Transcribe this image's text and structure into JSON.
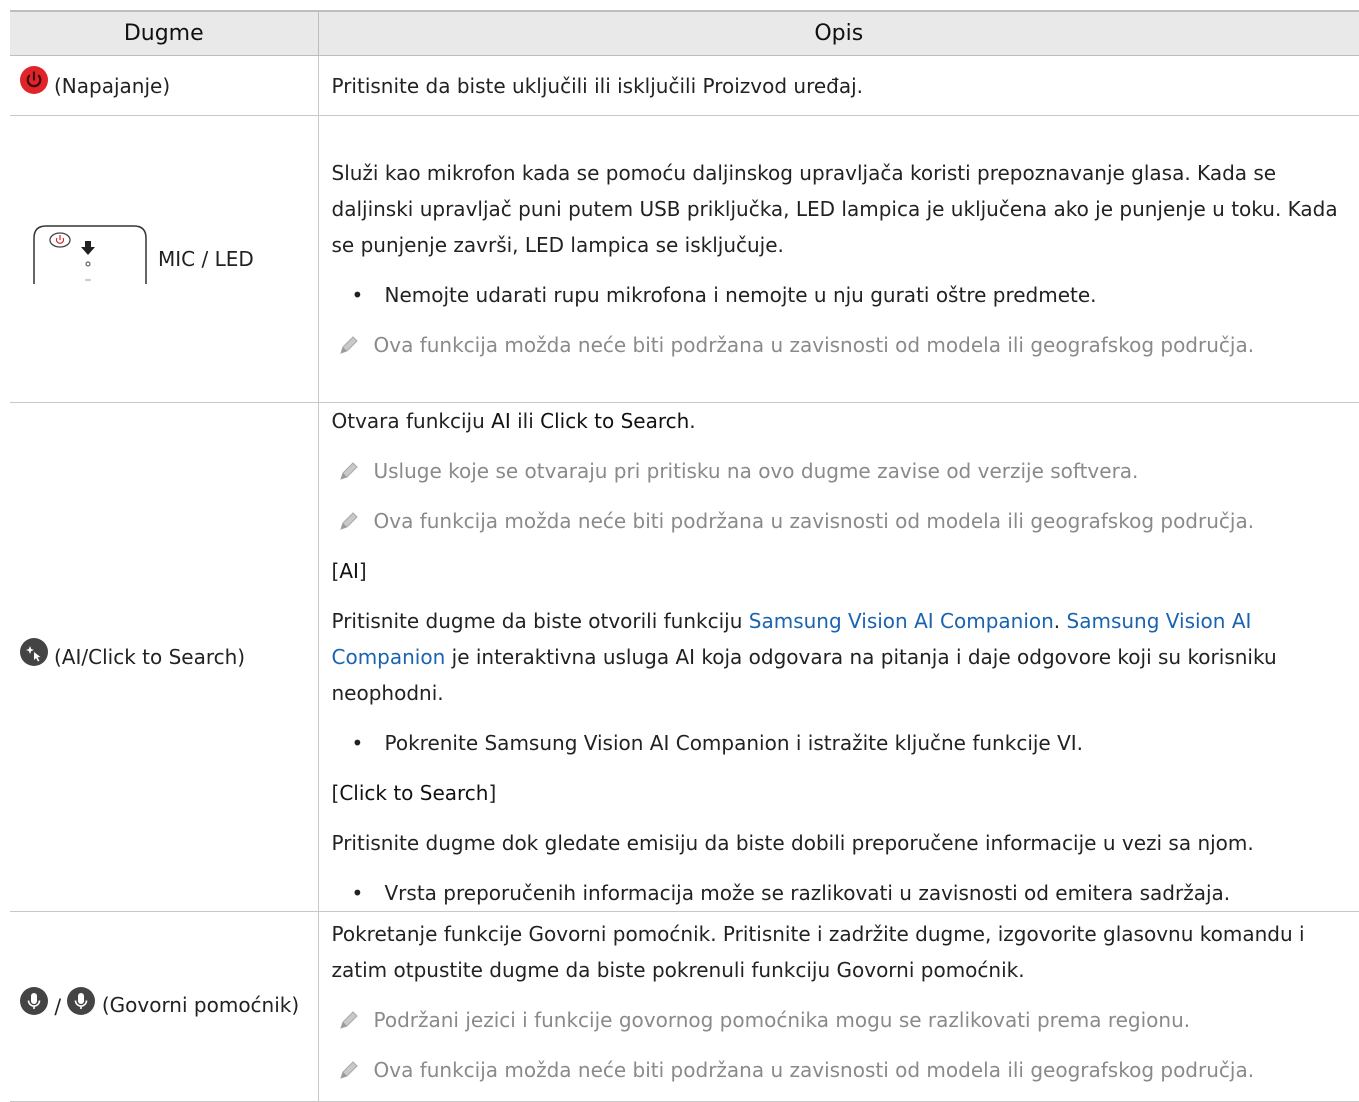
{
  "header": {
    "col1": "Dugme",
    "col2": "Opis"
  },
  "colors": {
    "power_red": "#e0242a",
    "icon_dark": "#444444",
    "link_blue": "#1a63b0",
    "note_gray": "#8a8a8a"
  },
  "rows": [
    {
      "label": "(Napajanje)",
      "icon": "power-icon",
      "description": "Pritisnite da biste uključili ili isključili Proizvod uređaj."
    },
    {
      "label": "MIC / LED",
      "icon": "remote-mic-led-icon",
      "p1": "Služi kao mikrofon kada se pomoću daljinskog upravljača koristi prepoznavanje glasa. Kada se daljinski upravljač puni putem USB priključka, LED lampica je uključena ako je punjenje u toku. Kada se punjenje završi, LED lampica se isključuje.",
      "bullet": "Nemojte udarati rupu mikrofona i nemojte u nju gurati oštre predmete.",
      "note": "Ova funkcija možda neće biti podržana u zavisnosti od modela ili geografskog područja."
    },
    {
      "label": "(AI/Click to Search)",
      "icon": "ai-click-to-search-icon",
      "intro_pre": "Otvara funkciju ",
      "intro_ai": "AI",
      "intro_mid": " ili ",
      "intro_cts": "Click to Search",
      "intro_end": ".",
      "note1": "Usluge koje se otvaraju pri pritisku na ovo dugme zavise od verzije softvera.",
      "note2": "Ova funkcija možda neće biti podržana u zavisnosti od modela ili geografskog područja.",
      "sec_ai_open": "[",
      "sec_ai": "AI",
      "sec_ai_close": "]",
      "ai_pre": "Pritisnite dugme da biste otvorili funkciju ",
      "ai_link1": "Samsung Vision AI Companion",
      "ai_dot": ". ",
      "ai_link2": "Samsung Vision AI Companion",
      "ai_rest": " je interaktivna usluga AI koja odgovara na pitanja i daje odgovore koji su korisniku neophodni.",
      "bullet1": "Pokrenite Samsung Vision AI Companion i istražite ključne funkcije VI.",
      "sec_cts_open": "[",
      "sec_cts": "Click to Search",
      "sec_cts_close": "]",
      "cts_text": "Pritisnite dugme dok gledate emisiju da biste dobili preporučene informacije u vezi sa njom.",
      "bullet2": "Vrsta preporučenih informacija može se razlikovati u zavisnosti od emitera sadržaja."
    },
    {
      "label_sep": "/",
      "label": "(Govorni pomoćnik)",
      "icon": "microphone-icon",
      "p1": "Pokretanje funkcije Govorni pomoćnik. Pritisnite i zadržite dugme, izgovorite glasovnu komandu i zatim otpustite dugme da biste pokrenuli funkciju Govorni pomoćnik.",
      "note1": "Podržani jezici i funkcije govornog pomoćnika mogu se razlikovati prema regionu.",
      "note2": "Ova funkcija možda neće biti podržana u zavisnosti od modela ili geografskog područja."
    }
  ]
}
